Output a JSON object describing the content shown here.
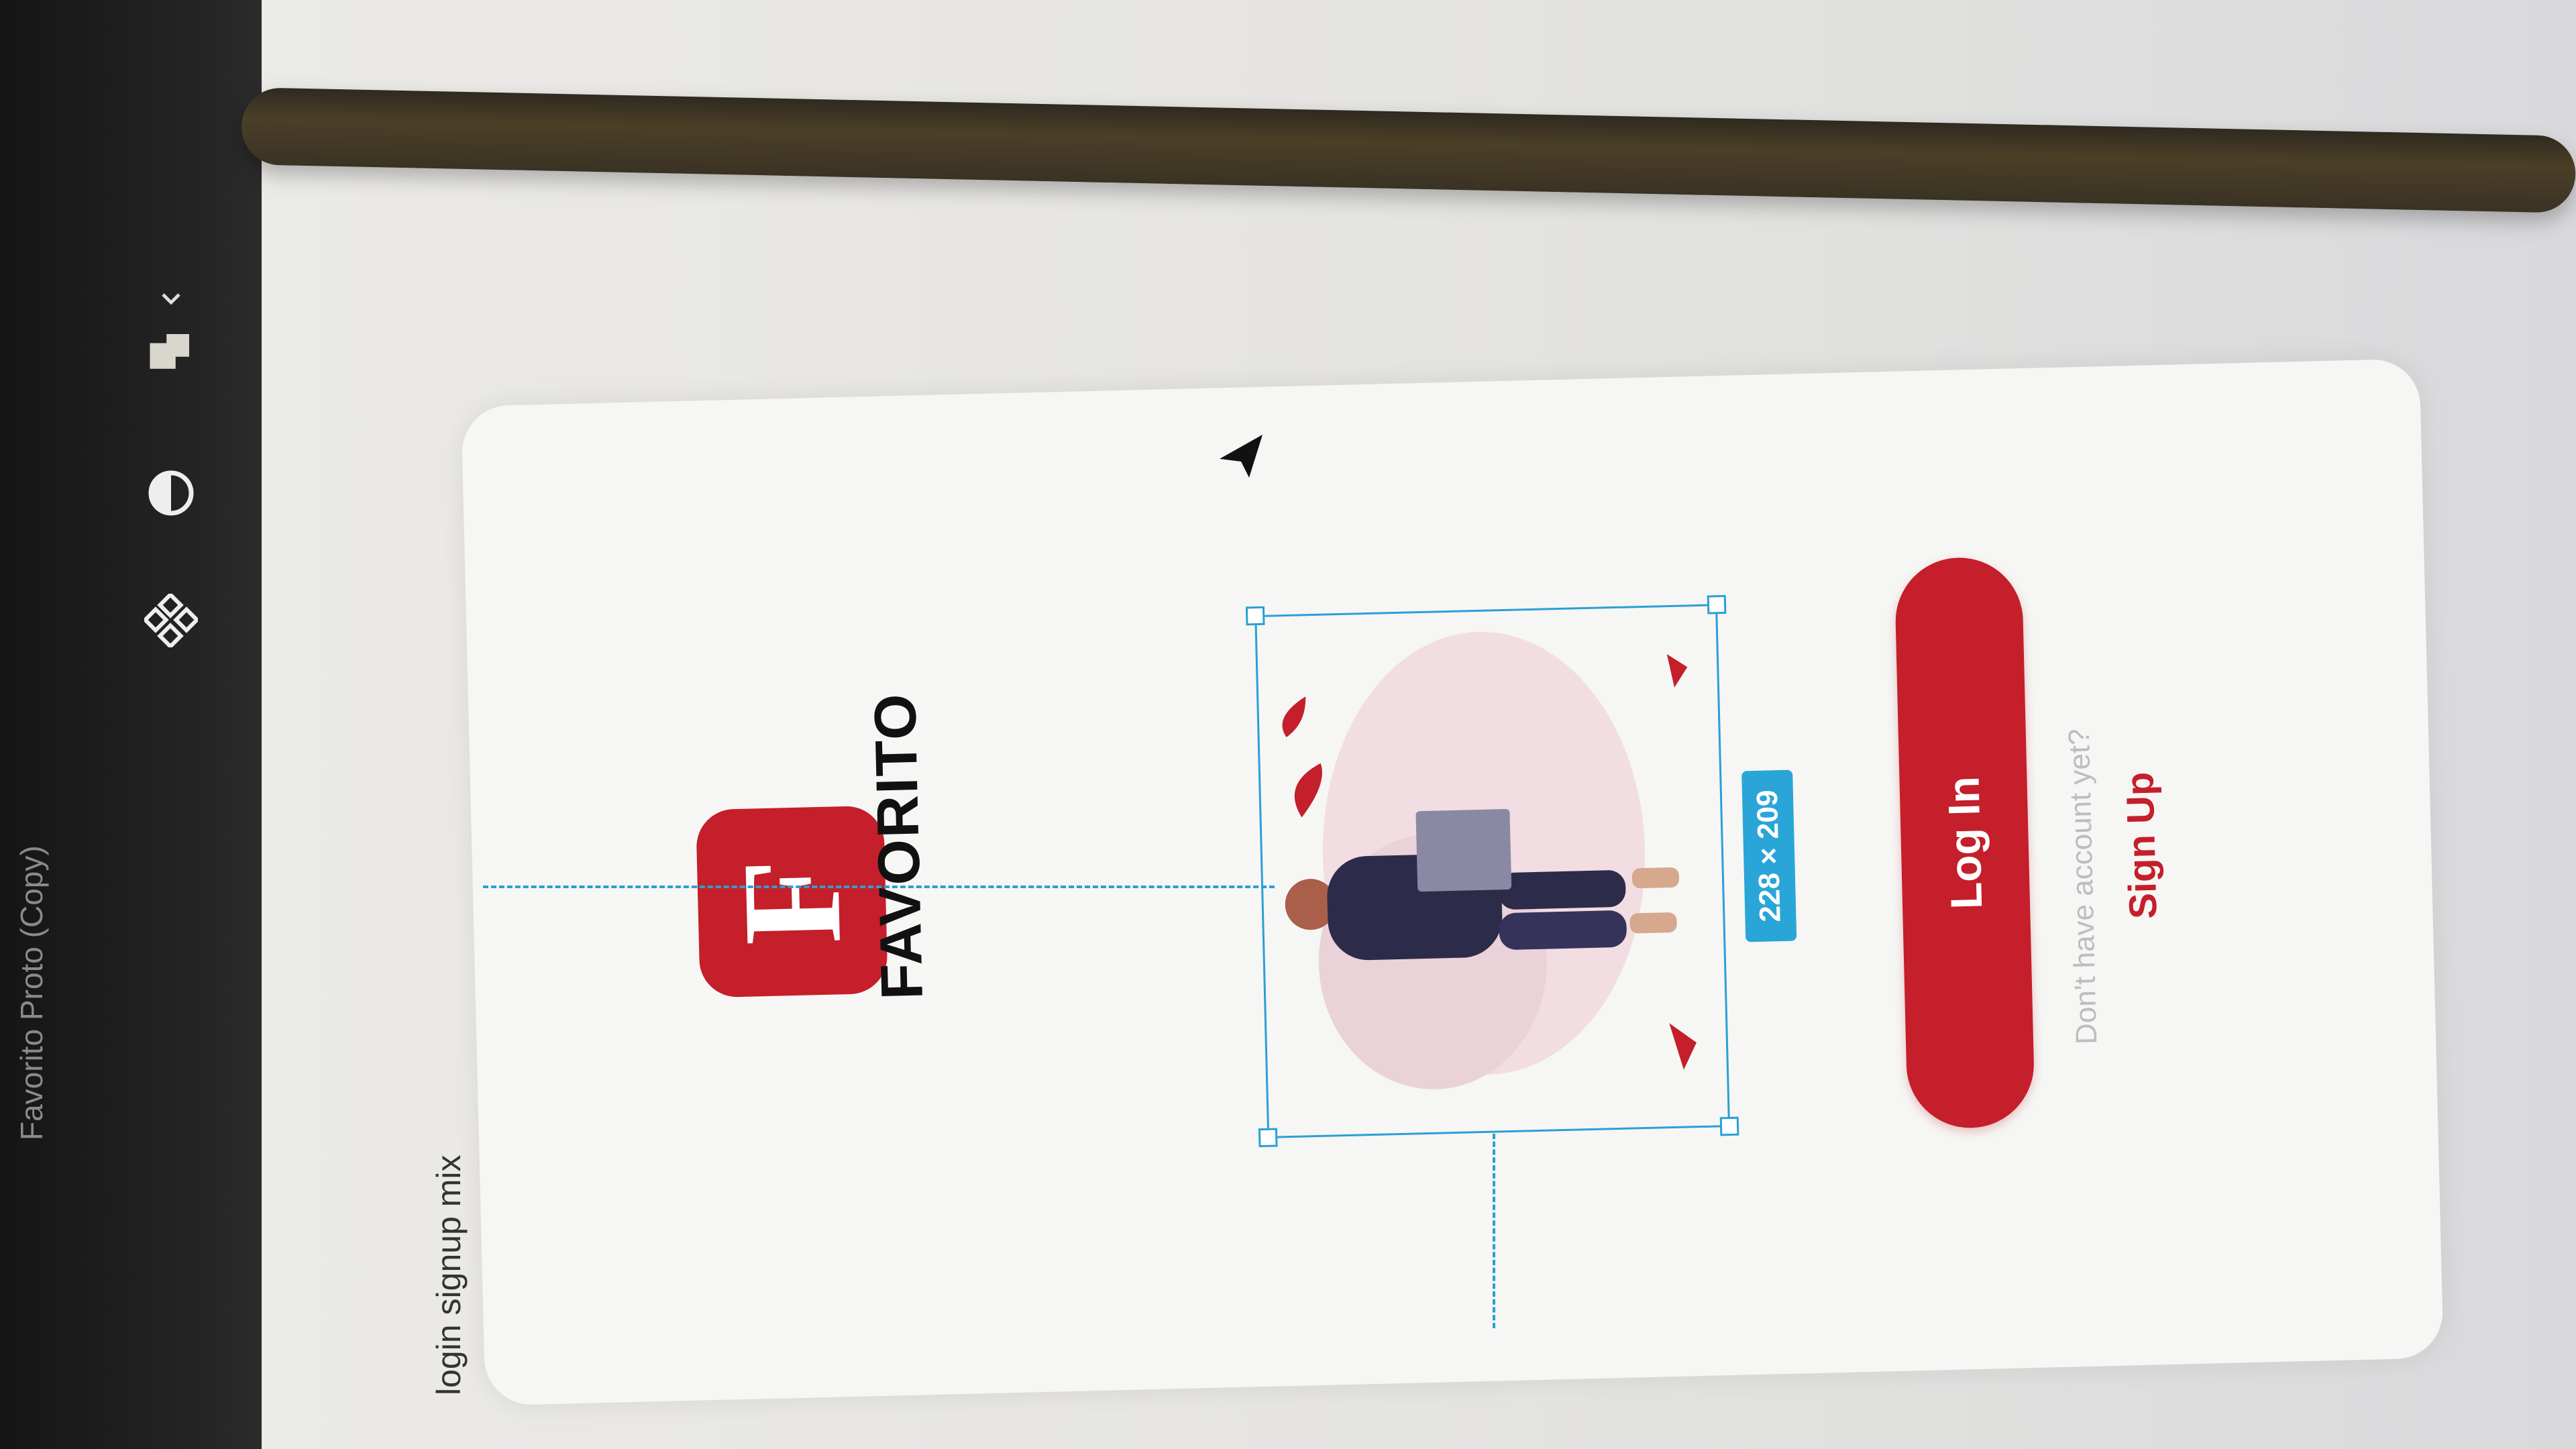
{
  "window": {
    "title": "Favorito Proto (Copy)"
  },
  "toolbar": {
    "tools": [
      {
        "name": "components-icon"
      },
      {
        "name": "contrast-icon"
      },
      {
        "name": "layers-icon"
      },
      {
        "name": "chevron-down-icon"
      }
    ]
  },
  "artboard": {
    "label": "login signup mix",
    "logo_letter": "F",
    "brand": "FAVORITO",
    "illustration": {
      "selection_size": "228 × 209"
    },
    "login_label": "Log In",
    "no_account_text": "Don't have account yet?",
    "signup_label": "Sign Up"
  },
  "colors": {
    "brand_red": "#c41f2a",
    "selection_blue": "#2b9fd6",
    "toolbar_bg": "#1c1c1c"
  }
}
